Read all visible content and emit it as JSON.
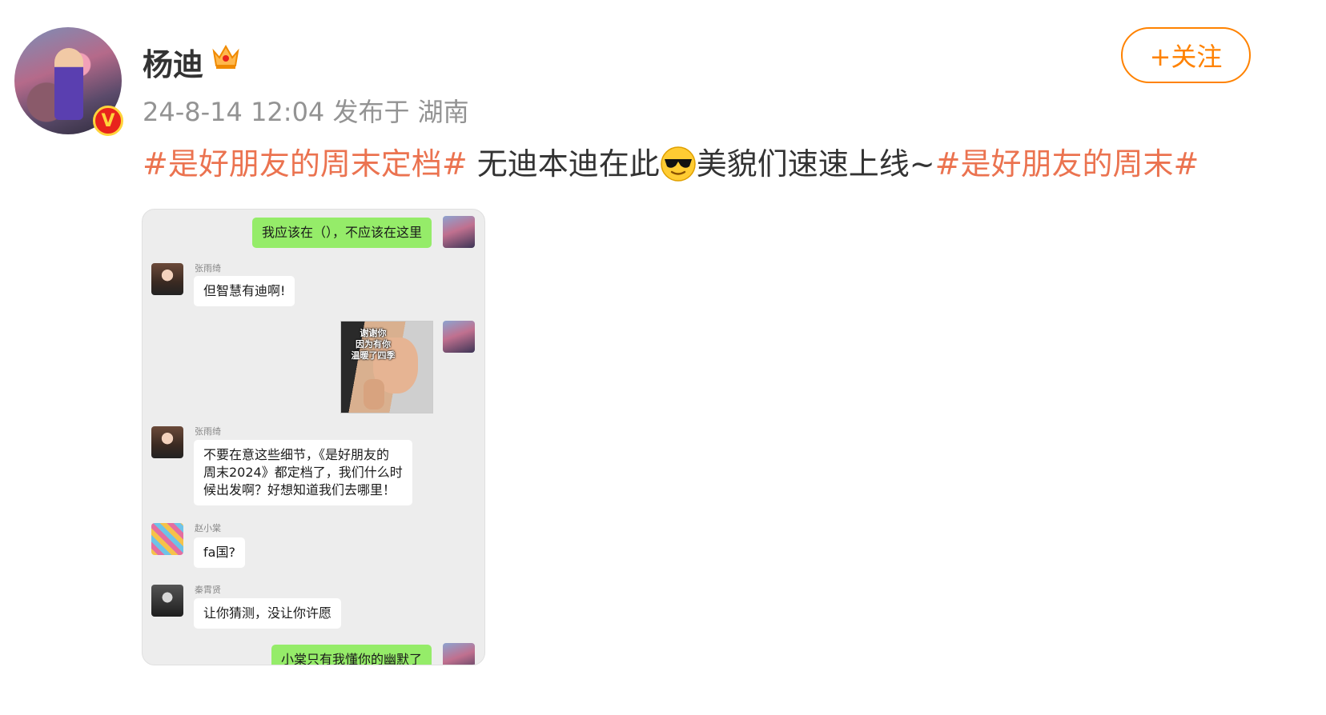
{
  "user": {
    "name": "杨迪",
    "time": "24-8-14 12:04",
    "source": "发布于 湖南",
    "verified_mark": "V"
  },
  "follow_label": "+关注",
  "post": {
    "tag1": "#是好朋友的周末定档#",
    "text_a": " 无迪本迪在此",
    "emoji": "cool-sunglasses-emoji",
    "text_b": "美貌们速速上线~",
    "tag2": "#是好朋友的周末#"
  },
  "chat": {
    "m1": "我应该在（），不应该在这里",
    "sender_zhang": "张雨绮",
    "m2": "但智慧有迪啊!",
    "sticker_caption": [
      "谢谢你",
      "因为有你",
      "温暖了四季"
    ],
    "m3_lines": [
      "不要在意这些细节，《是好朋友的",
      "周末2024》都定档了，我们什么时",
      "候出发啊？好想知道我们去哪里！"
    ],
    "sender_zhao": "赵小棠",
    "m4": "fa国?",
    "sender_qin": "秦霄贤",
    "m5": "让你猜测，没让你许愿",
    "m6": "小棠只有我懂你的幽默了"
  },
  "colors": {
    "topic": "#eb7350",
    "follow": "#ff8200",
    "bubble_self": "#95ec69",
    "chat_bg": "#ededed"
  }
}
